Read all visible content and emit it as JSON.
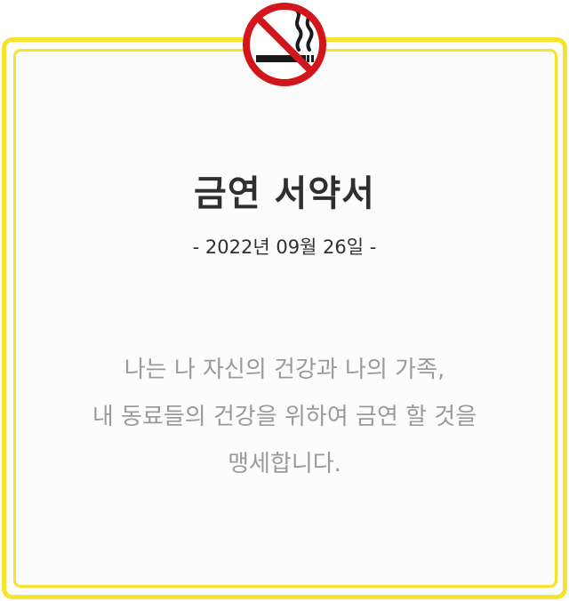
{
  "icon": "no-smoking-icon",
  "colors": {
    "frame": "#f7e32c",
    "sign_red": "#d3151c",
    "title": "#2f2f2f",
    "body_text": "#9a9a9a"
  },
  "title": "금연 서약서",
  "date": "- 2022년 09월 26일 -",
  "pledge": {
    "line1": "나는 나 자신의 건강과 나의 가족,",
    "line2": "내 동료들의 건강을 위하여 금연 할 것을",
    "line3": "맹세합니다."
  }
}
